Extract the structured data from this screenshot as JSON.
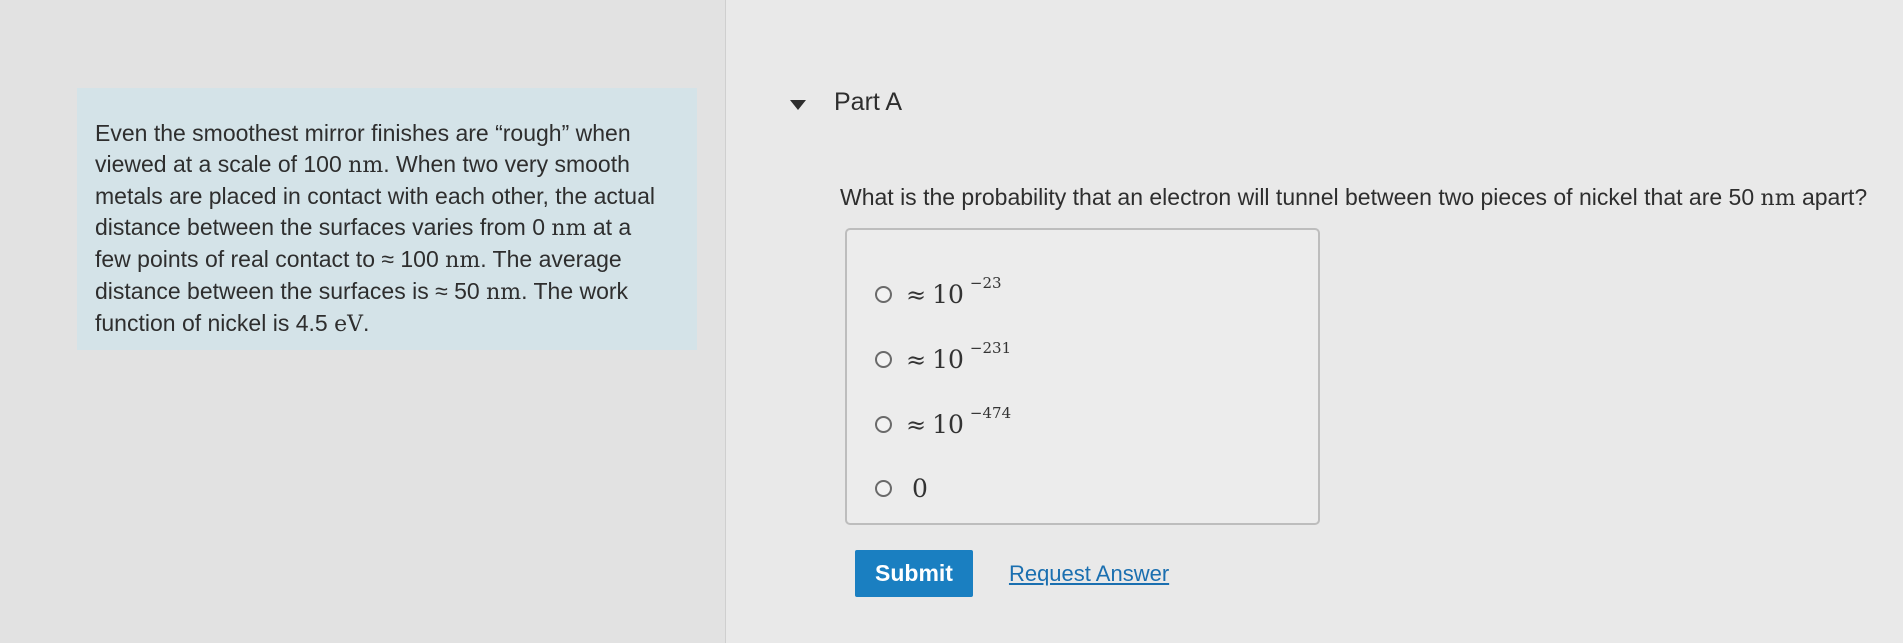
{
  "intro": {
    "text": "Even the smoothest mirror finishes are “rough” when viewed at a scale of 100 ",
    "unit_nm_1": "nm",
    "text_2": ". When two very smooth metals are placed in contact with each other, the actual distance between the surfaces varies from 0 ",
    "unit_nm_2": "nm",
    "text_3": " at a few points of real contact to ≈ 100 ",
    "unit_nm_3": "nm",
    "text_4": ". The average distance between the surfaces is ≈ 50 ",
    "unit_nm_4": "nm",
    "text_5": ". The work function of nickel is 4.5 ",
    "unit_ev": "eV",
    "text_6": "."
  },
  "part": {
    "title": "Part A"
  },
  "question": {
    "text": "What is the probability that an electron will tunnel between two pieces of nickel that are 50 ",
    "unit": "nm",
    "text_end": " apart?"
  },
  "options": [
    {
      "approx": "≈",
      "base": "10",
      "exp": "−23"
    },
    {
      "approx": "≈",
      "base": "10",
      "exp": "−231"
    },
    {
      "approx": "≈",
      "base": "10",
      "exp": "−474"
    },
    {
      "approx": "",
      "base": "0",
      "exp": ""
    }
  ],
  "actions": {
    "submit_label": "Submit",
    "request_label": "Request Answer"
  },
  "colors": {
    "intro_bg": "#d4e3e8",
    "submit_bg": "#1a7fc1",
    "link": "#1a6fb0"
  }
}
